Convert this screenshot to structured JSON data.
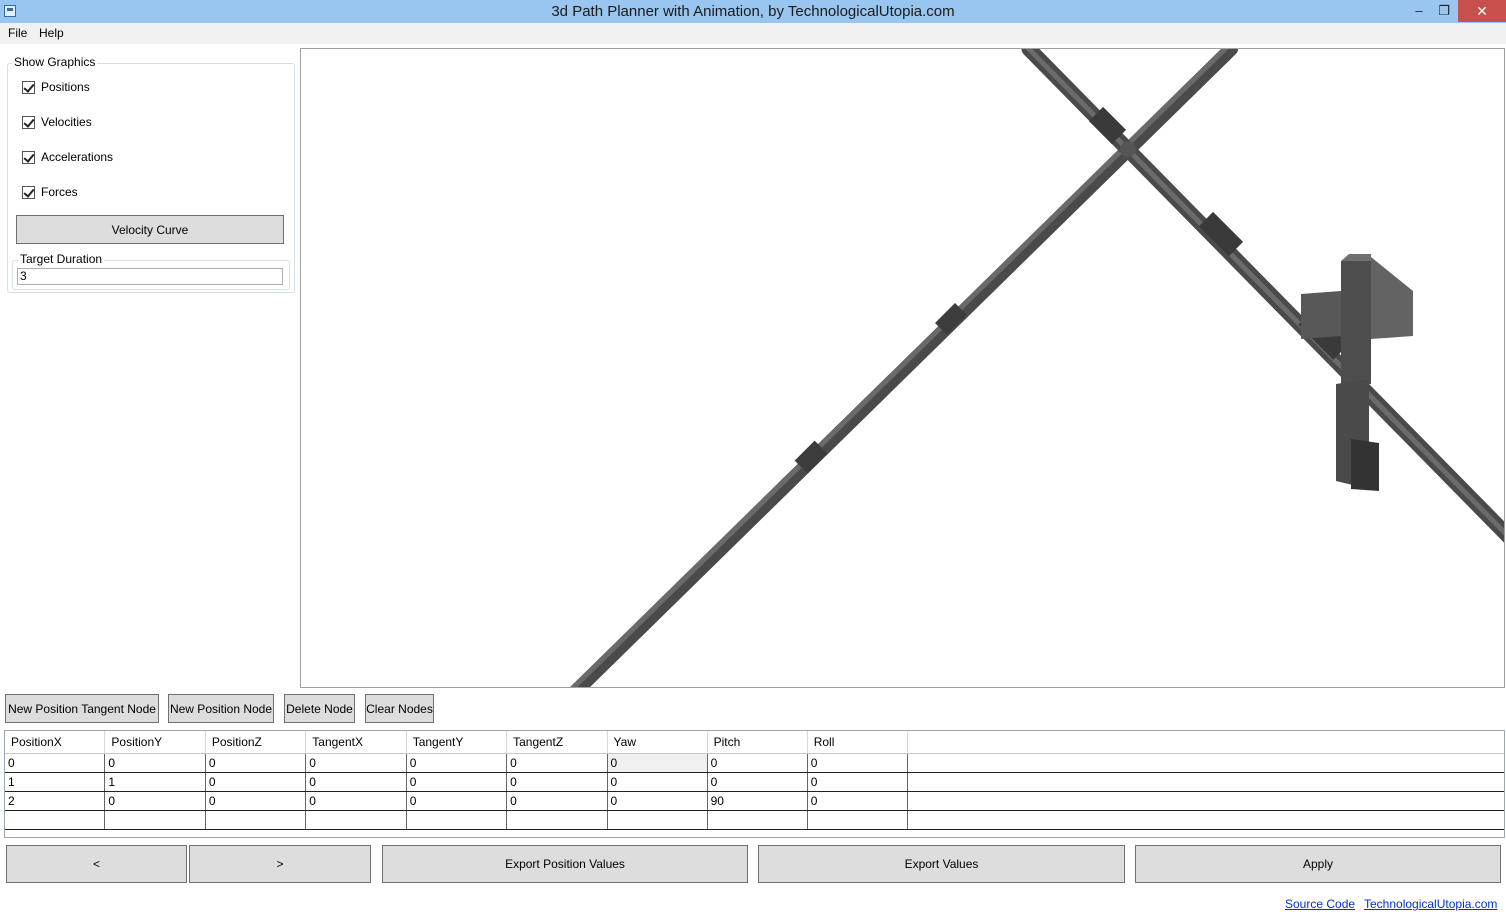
{
  "window": {
    "title": "3d Path Planner with Animation, by TechnologicalUtopia.com",
    "minimize_glyph": "‒",
    "maximize_glyph": "❐",
    "close_glyph": "✕"
  },
  "menu": {
    "file": "File",
    "help": "Help"
  },
  "show_graphics": {
    "title": "Show Graphics",
    "checkboxes": [
      {
        "label": "Positions",
        "checked": true
      },
      {
        "label": "Velocities",
        "checked": true
      },
      {
        "label": "Accelerations",
        "checked": true
      },
      {
        "label": "Forces",
        "checked": true
      }
    ],
    "velocity_curve_label": "Velocity Curve",
    "target_duration_title": "Target Duration",
    "target_duration_value": "3"
  },
  "node_buttons": {
    "new_position_tangent": "New Position Tangent Node",
    "new_position": "New Position Node",
    "delete": "Delete Node",
    "clear": "Clear Nodes"
  },
  "table": {
    "columns": [
      "PositionX",
      "PositionY",
      "PositionZ",
      "TangentX",
      "TangentY",
      "TangentZ",
      "Yaw",
      "Pitch",
      "Roll"
    ],
    "rows": [
      [
        "0",
        "0",
        "0",
        "0",
        "0",
        "0",
        "0",
        "0",
        "0"
      ],
      [
        "1",
        "1",
        "0",
        "0",
        "0",
        "0",
        "0",
        "0",
        "0"
      ],
      [
        "2",
        "0",
        "0",
        "0",
        "0",
        "0",
        "0",
        "90",
        "0"
      ]
    ]
  },
  "bottom_buttons": {
    "prev": "<",
    "next": ">",
    "export_position": "Export Position Values",
    "export_values": "Export Values",
    "apply": "Apply"
  },
  "links": {
    "source_code": "Source Code",
    "site": "TechnologicalUtopia.com"
  },
  "colors": {
    "titlebar": "#99c6f0",
    "close": "#c7504c",
    "pipe": "#555555"
  }
}
